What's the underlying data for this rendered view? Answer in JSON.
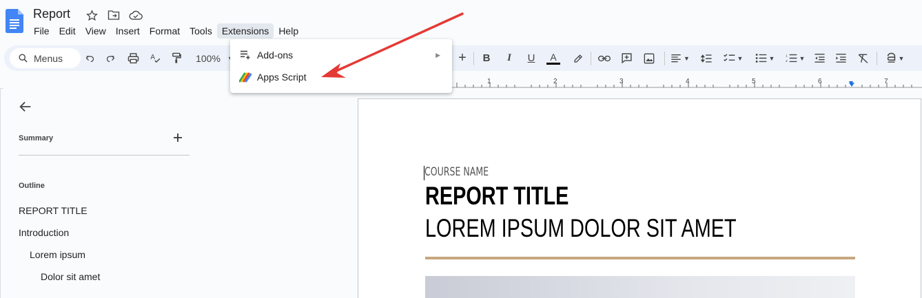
{
  "app": {
    "title": "Report",
    "menus": [
      "File",
      "Edit",
      "View",
      "Insert",
      "Format",
      "Tools",
      "Extensions",
      "Help"
    ],
    "active_menu": "Extensions"
  },
  "toolbar": {
    "search_label": "Menus",
    "zoom": "100%",
    "icons": [
      "undo-icon",
      "redo-icon",
      "print-icon",
      "spellcheck-icon",
      "paint-format-icon"
    ]
  },
  "ruler": {
    "numbers": [
      "1",
      "2",
      "3",
      "4",
      "5",
      "6",
      "7"
    ]
  },
  "extensions_menu": {
    "items": [
      {
        "label": "Add-ons",
        "icon": "add-ons-icon",
        "has_submenu": true
      },
      {
        "label": "Apps Script",
        "icon": "apps-script-icon",
        "has_submenu": false
      }
    ]
  },
  "sidebar": {
    "summary_label": "Summary",
    "outline_label": "Outline",
    "outline": [
      {
        "label": "REPORT TITLE",
        "level": 0
      },
      {
        "label": "Introduction",
        "level": 0
      },
      {
        "label": "Lorem ipsum",
        "level": 1
      },
      {
        "label": "Dolor sit amet",
        "level": 2
      }
    ]
  },
  "document": {
    "course_name": "COURSE NAME",
    "report_title": "REPORT TITLE",
    "subtitle": "LOREM IPSUM DOLOR SIT AMET"
  },
  "colors": {
    "accent_rule": "#c6a77f",
    "annotation_arrow": "#e53935",
    "docs_blue": "#4285f4"
  }
}
